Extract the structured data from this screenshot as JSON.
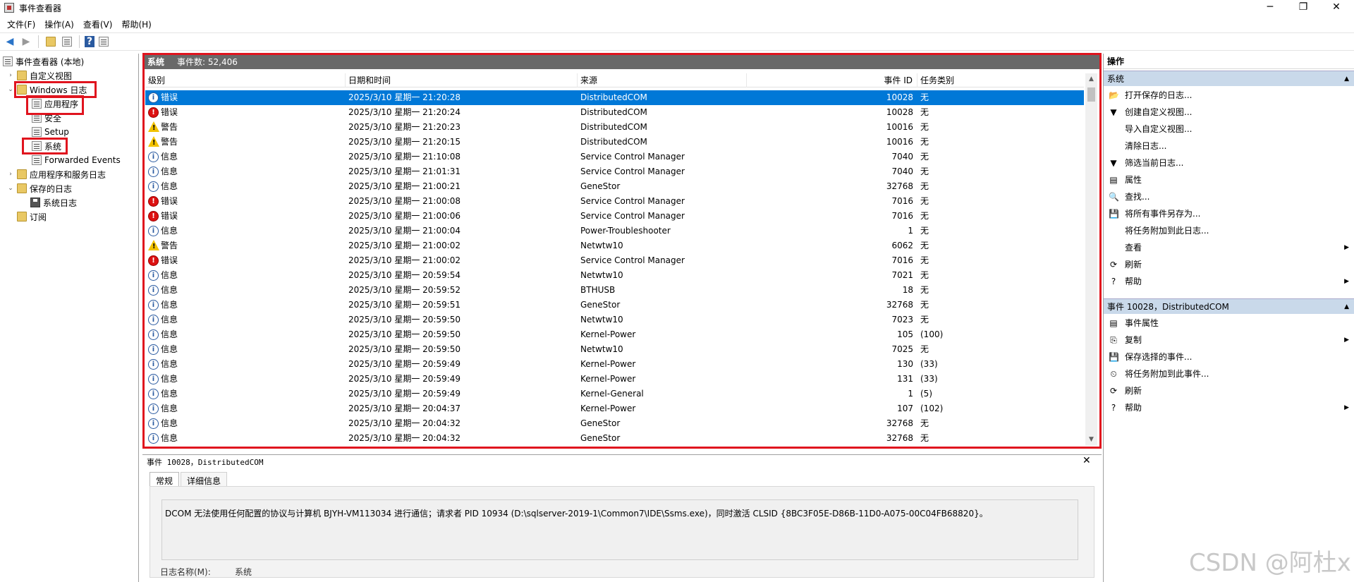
{
  "window": {
    "title": "事件查看器",
    "controls": [
      "─",
      "❐",
      "✕"
    ]
  },
  "menu": [
    "文件(F)",
    "操作(A)",
    "查看(V)",
    "帮助(H)"
  ],
  "toolbar_icons": [
    "back-icon",
    "forward-icon",
    "up-folder-icon",
    "console-tree-icon",
    "help-icon",
    "panel-icon"
  ],
  "tree": {
    "root": "事件查看器 (本地)",
    "custom_views": "自定义视图",
    "windows_logs": "Windows 日志",
    "application": "应用程序",
    "security": "安全",
    "setup": "Setup",
    "system": "系统",
    "forwarded": "Forwarded Events",
    "app_services": "应用程序和服务日志",
    "saved_logs": "保存的日志",
    "system_log": "系统日志",
    "subscriptions": "订阅"
  },
  "list": {
    "title": "系统",
    "count": "事件数: 52,406",
    "columns": [
      "级别",
      "日期和时间",
      "来源",
      "事件 ID",
      "任务类别"
    ],
    "rows": [
      {
        "level": "info",
        "level_text": "错误",
        "datetime": "2025/3/10 星期一 21:20:28",
        "source": "DistributedCOM",
        "id": "10028",
        "task": "无"
      },
      {
        "level": "err",
        "level_text": "错误",
        "datetime": "2025/3/10 星期一 21:20:24",
        "source": "DistributedCOM",
        "id": "10028",
        "task": "无"
      },
      {
        "level": "warn",
        "level_text": "警告",
        "datetime": "2025/3/10 星期一 21:20:23",
        "source": "DistributedCOM",
        "id": "10016",
        "task": "无"
      },
      {
        "level": "warn",
        "level_text": "警告",
        "datetime": "2025/3/10 星期一 21:20:15",
        "source": "DistributedCOM",
        "id": "10016",
        "task": "无"
      },
      {
        "level": "info",
        "level_text": "信息",
        "datetime": "2025/3/10 星期一 21:10:08",
        "source": "Service Control Manager",
        "id": "7040",
        "task": "无"
      },
      {
        "level": "info",
        "level_text": "信息",
        "datetime": "2025/3/10 星期一 21:01:31",
        "source": "Service Control Manager",
        "id": "7040",
        "task": "无"
      },
      {
        "level": "info",
        "level_text": "信息",
        "datetime": "2025/3/10 星期一 21:00:21",
        "source": "GeneStor",
        "id": "32768",
        "task": "无"
      },
      {
        "level": "err",
        "level_text": "错误",
        "datetime": "2025/3/10 星期一 21:00:08",
        "source": "Service Control Manager",
        "id": "7016",
        "task": "无"
      },
      {
        "level": "err",
        "level_text": "错误",
        "datetime": "2025/3/10 星期一 21:00:06",
        "source": "Service Control Manager",
        "id": "7016",
        "task": "无"
      },
      {
        "level": "info",
        "level_text": "信息",
        "datetime": "2025/3/10 星期一 21:00:04",
        "source": "Power-Troubleshooter",
        "id": "1",
        "task": "无"
      },
      {
        "level": "warn",
        "level_text": "警告",
        "datetime": "2025/3/10 星期一 21:00:02",
        "source": "Netwtw10",
        "id": "6062",
        "task": "无"
      },
      {
        "level": "err",
        "level_text": "错误",
        "datetime": "2025/3/10 星期一 21:00:02",
        "source": "Service Control Manager",
        "id": "7016",
        "task": "无"
      },
      {
        "level": "info",
        "level_text": "信息",
        "datetime": "2025/3/10 星期一 20:59:54",
        "source": "Netwtw10",
        "id": "7021",
        "task": "无"
      },
      {
        "level": "info",
        "level_text": "信息",
        "datetime": "2025/3/10 星期一 20:59:52",
        "source": "BTHUSB",
        "id": "18",
        "task": "无"
      },
      {
        "level": "info",
        "level_text": "信息",
        "datetime": "2025/3/10 星期一 20:59:51",
        "source": "GeneStor",
        "id": "32768",
        "task": "无"
      },
      {
        "level": "info",
        "level_text": "信息",
        "datetime": "2025/3/10 星期一 20:59:50",
        "source": "Netwtw10",
        "id": "7023",
        "task": "无"
      },
      {
        "level": "info",
        "level_text": "信息",
        "datetime": "2025/3/10 星期一 20:59:50",
        "source": "Kernel-Power",
        "id": "105",
        "task": "(100)"
      },
      {
        "level": "info",
        "level_text": "信息",
        "datetime": "2025/3/10 星期一 20:59:50",
        "source": "Netwtw10",
        "id": "7025",
        "task": "无"
      },
      {
        "level": "info",
        "level_text": "信息",
        "datetime": "2025/3/10 星期一 20:59:49",
        "source": "Kernel-Power",
        "id": "130",
        "task": "(33)"
      },
      {
        "level": "info",
        "level_text": "信息",
        "datetime": "2025/3/10 星期一 20:59:49",
        "source": "Kernel-Power",
        "id": "131",
        "task": "(33)"
      },
      {
        "level": "info",
        "level_text": "信息",
        "datetime": "2025/3/10 星期一 20:59:49",
        "source": "Kernel-General",
        "id": "1",
        "task": "(5)"
      },
      {
        "level": "info",
        "level_text": "信息",
        "datetime": "2025/3/10 星期一 20:04:37",
        "source": "Kernel-Power",
        "id": "107",
        "task": "(102)"
      },
      {
        "level": "info",
        "level_text": "信息",
        "datetime": "2025/3/10 星期一 20:04:32",
        "source": "GeneStor",
        "id": "32768",
        "task": "无"
      },
      {
        "level": "info",
        "level_text": "信息",
        "datetime": "2025/3/10 星期一 20:04:32",
        "source": "GeneStor",
        "id": "32768",
        "task": "无"
      }
    ]
  },
  "detail": {
    "header": "事件 10028，DistributedCOM",
    "tabs": [
      "常规",
      "详细信息"
    ],
    "message": "DCOM 无法使用任何配置的协议与计算机 BJYH-VM113034 进行通信；请求者 PID    10934 (D:\\sqlserver-2019-1\\Common7\\IDE\\Ssms.exe)，同时激活 CLSID {8BC3F05E-D86B-11D0-A075-00C04FB68820}。",
    "log_name_label": "日志名称(M):",
    "log_name_value": "系统"
  },
  "actions": {
    "header": "操作",
    "section1": "系统",
    "items1": [
      "打开保存的日志...",
      "创建自定义视图...",
      "导入自定义视图...",
      "清除日志...",
      "筛选当前日志...",
      "属性",
      "查找...",
      "将所有事件另存为...",
      "将任务附加到此日志...",
      "查看",
      "刷新",
      "帮助"
    ],
    "section2": "事件 10028，DistributedCOM",
    "items2": [
      "事件属性",
      "复制",
      "保存选择的事件...",
      "将任务附加到此事件...",
      "刷新",
      "帮助"
    ]
  },
  "watermark": "CSDN @阿杜x",
  "colors": {
    "selection": "#0078d7",
    "highlight_box": "#e0141e",
    "list_header": "#696969"
  }
}
